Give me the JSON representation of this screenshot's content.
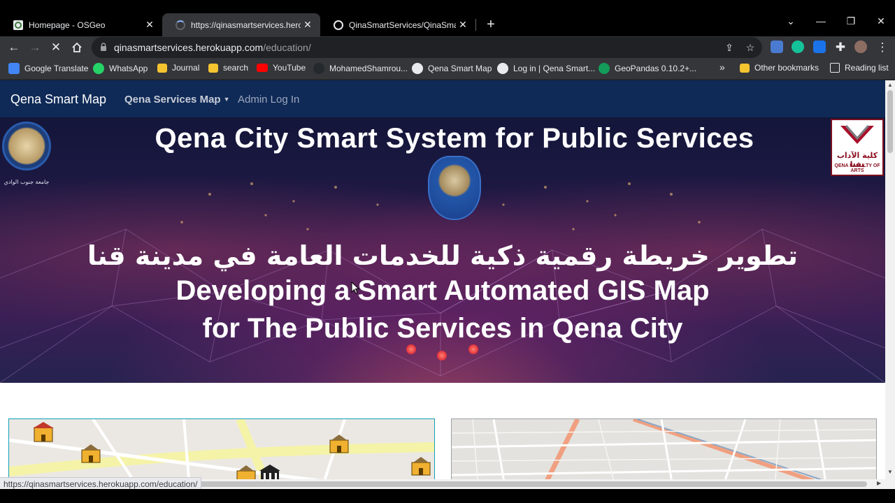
{
  "tabs": [
    {
      "title": "Homepage - OSGeo",
      "active": false
    },
    {
      "title": "https://qinasmartservices.herokua",
      "active": true
    },
    {
      "title": "QinaSmartServices/QinaSmartMa",
      "active": false
    }
  ],
  "window_controls": {
    "dropdown": "⌄",
    "minimize": "—",
    "restore": "❐",
    "close": "✕"
  },
  "toolbar": {
    "url_domain": "qinasmartservices.herokuapp.com",
    "url_path": "/education/"
  },
  "bookmarks": [
    {
      "label": "Google Translate",
      "icon": "google-translate-icon",
      "color": "#4285f4"
    },
    {
      "label": "WhatsApp",
      "icon": "whatsapp-icon",
      "color": "#25d366"
    },
    {
      "label": "Journal",
      "icon": "folder-icon",
      "color": "#f4c430"
    },
    {
      "label": "search",
      "icon": "folder-icon",
      "color": "#f4c430"
    },
    {
      "label": "YouTube",
      "icon": "youtube-icon",
      "color": "#ff0000"
    },
    {
      "label": "MohamedShamrou...",
      "icon": "github-icon",
      "color": "#24292e"
    },
    {
      "label": "Qena Smart Map",
      "icon": "globe-icon",
      "color": "#e8eaed"
    },
    {
      "label": "Log in | Qena Smart...",
      "icon": "globe-icon",
      "color": "#e8eaed"
    },
    {
      "label": "GeoPandas 0.10.2+...",
      "icon": "geopandas-icon",
      "color": "#139c5a"
    },
    {
      "label": "»",
      "icon": "overflow-icon",
      "color": "#e8eaed"
    },
    {
      "label": "Other bookmarks",
      "icon": "folder-icon",
      "color": "#f4c430"
    },
    {
      "label": "Reading list",
      "icon": "reading-list-icon",
      "color": "#e8eaed"
    }
  ],
  "site": {
    "brand": "Qena Smart Map",
    "nav_services": "Qena Services Map",
    "nav_admin": "Admin Log In"
  },
  "banner": {
    "title": "Qena City Smart System for Public Services",
    "arabic": "تطوير خريطة رقمية ذكية للخدمات العامة في مدينة قنا",
    "english_line1": "Developing a Smart Automated GIS Map",
    "english_line2": "for The Public Services in Qena City",
    "left_logo_caption": "جامعة جنوب الوادي",
    "right_logo_ar": "كلية الآداب بقنا",
    "right_logo_en": "QENA FACULTY OF ARTS"
  },
  "status_bar_url": "https://qinasmartservices.herokuapp.com/education/",
  "colors": {
    "navbar": "#0f2a57",
    "active_tab": "#35363a",
    "tabstrip": "#000000"
  }
}
